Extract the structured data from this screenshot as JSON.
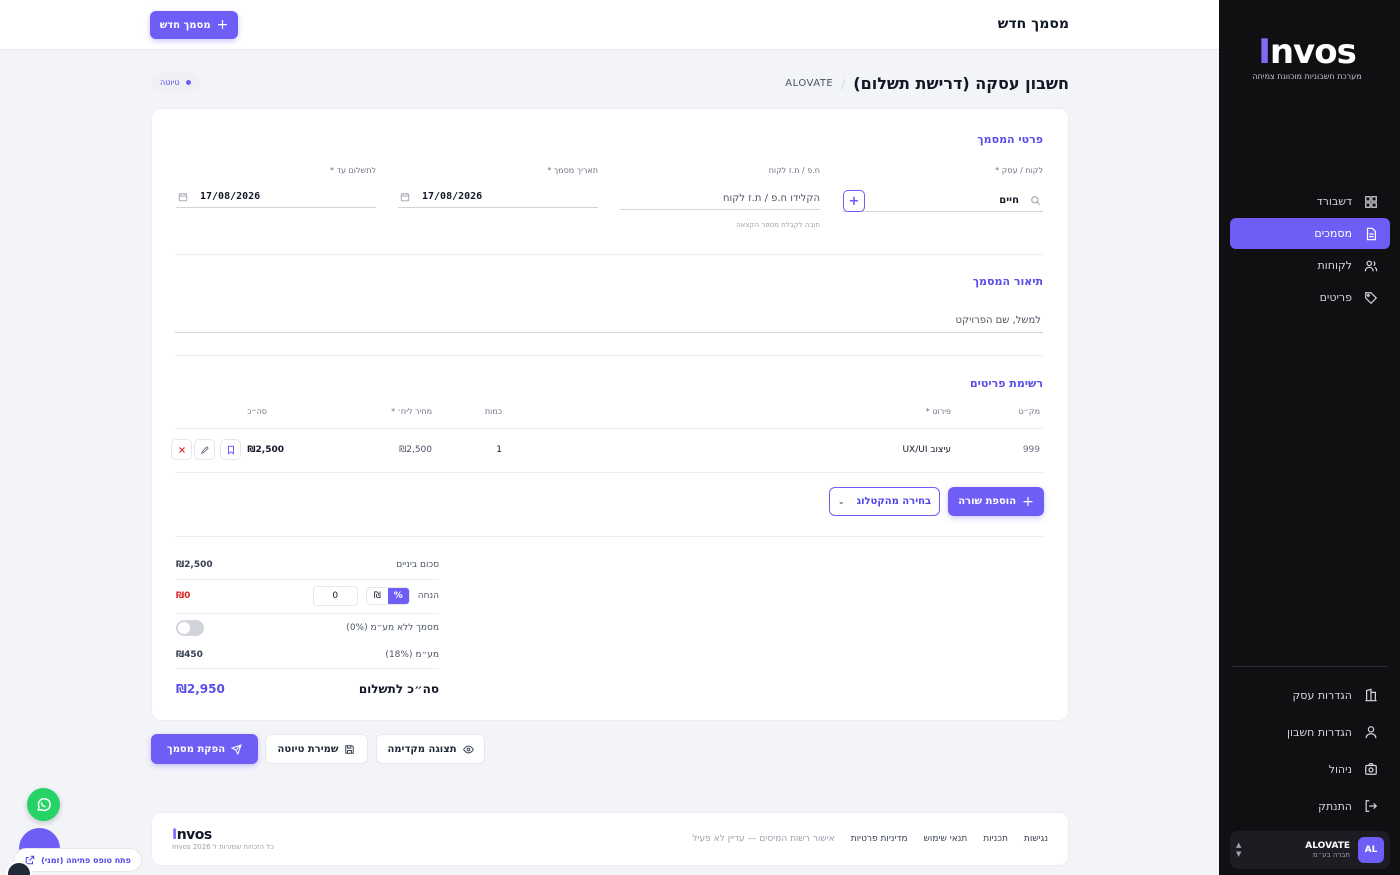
{
  "brand": {
    "logo": "nvos",
    "logo_i": "I",
    "tagline": "מערכת חשבוניות מוכוונת צמיחה"
  },
  "sidebar": {
    "items": [
      {
        "label": "דשבורד",
        "icon": "grid-icon"
      },
      {
        "label": "מסמכים",
        "icon": "document-icon",
        "active": true
      },
      {
        "label": "לקוחות",
        "icon": "users-icon"
      },
      {
        "label": "פריטים",
        "icon": "tag-icon"
      }
    ],
    "bottom_items": [
      {
        "label": "הגדרות עסק",
        "icon": "building-icon"
      },
      {
        "label": "הגדרות חשבון",
        "icon": "user-icon"
      },
      {
        "label": "ניהול",
        "icon": "camera-icon"
      },
      {
        "label": "התנתק",
        "icon": "logout-icon"
      }
    ],
    "account": {
      "initials": "AL",
      "name": "ALOVATE",
      "type": "חברה בע״מ"
    }
  },
  "topbar": {
    "title": "מסמך חדש",
    "new_button": "מסמך חדש"
  },
  "page": {
    "title": "חשבון עסקה (דרישת תשלום)",
    "separator": "/",
    "company": "ALOVATE",
    "status": "טיוטה"
  },
  "details": {
    "section_title": "פרטי המסמך",
    "client_label": "לקוח / עסק *",
    "client_value": "חיים",
    "taxid_label": "ח.פ / ת.ז לקוח",
    "taxid_placeholder": "הקלידו ח.פ / ת.ז לקוח",
    "taxid_hint": "חובה לקבלת מספר הקצאה",
    "date_label": "תאריך מסמך *",
    "date_value": "17/08/2026",
    "due_label": "לתשלום עד *",
    "due_value": "17/08/2026"
  },
  "description": {
    "section_title": "תיאור המסמך",
    "placeholder": "למשל, שם הפרויקט"
  },
  "items": {
    "section_title": "רשימת פריטים",
    "headers": {
      "sku": "מק״ט",
      "desc": "פירוט *",
      "qty": "כמות",
      "price": "מחיר ליח׳ *",
      "total": "סה״כ"
    },
    "rows": [
      {
        "sku": "999",
        "desc": "עיצוב UX/UI",
        "qty": "1",
        "price": "₪2,500",
        "total": "₪2,500"
      }
    ],
    "add_row": "הוספת שורה",
    "catalog": "בחירה מהקטלוג"
  },
  "summary": {
    "subtotal_label": "סכום ביניים",
    "subtotal": "₪2,500",
    "discount_label": "הנחה",
    "discount_pct": "%",
    "discount_ils": "₪",
    "discount_input": "0",
    "discount_value": "₪0",
    "novat_label": "מסמך ללא מע״מ (0%)",
    "vat_label": "מע״מ (18%)",
    "vat": "₪450",
    "total_label": "סה״כ לתשלום",
    "total": "₪2,950"
  },
  "actions": {
    "issue": "הפקת מסמך",
    "save_draft": "שמירת טיוטה",
    "preview": "תצוגה מקדימה"
  },
  "footer": {
    "links": [
      "נגישות",
      "תכניות",
      "תנאי שימוש",
      "מדיניות פרטיות"
    ],
    "tax_note": "אישור רשות המיסים — עדיין לא פעיל",
    "logo": "nvos",
    "logo_i": "I",
    "copyright": "כל הזכויות שמורות ל 2026 Invos"
  },
  "floating": {
    "ticket": "פתח טופס פתיחה (זמני)"
  },
  "colors": {
    "accent": "#6e5ef6",
    "sidebar_bg": "#101013",
    "danger": "#dc2626"
  }
}
